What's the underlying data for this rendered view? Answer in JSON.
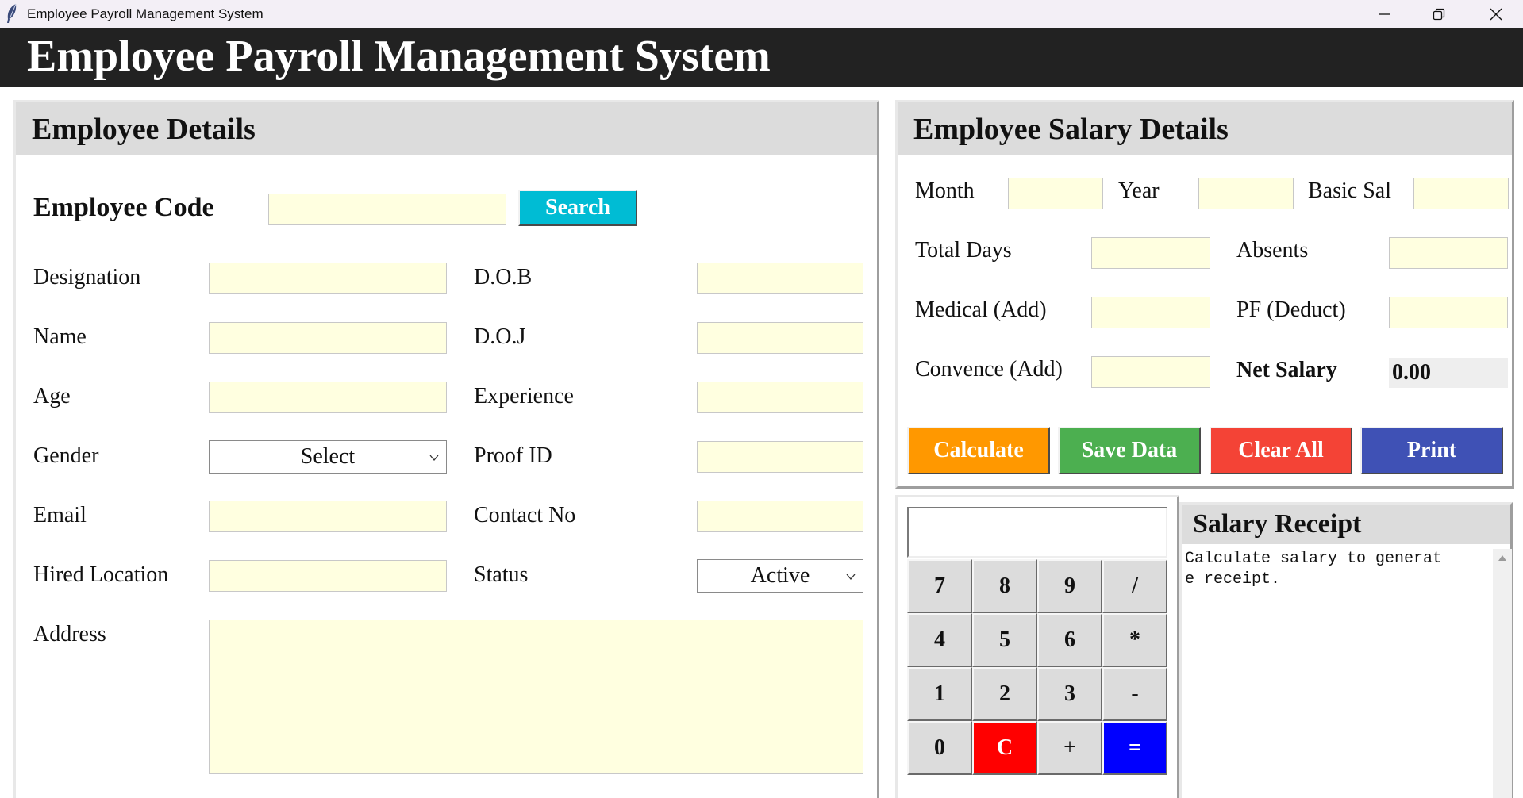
{
  "window": {
    "title": "Employee Payroll Management System",
    "icon": "feather-icon",
    "controls": [
      "minimize-icon",
      "restore-icon",
      "close-icon"
    ]
  },
  "header": {
    "title": "Employee Payroll Management System"
  },
  "employee_details": {
    "heading": "Employee Details",
    "code_label": "Employee Code",
    "code_value": "",
    "search_label": "Search",
    "fields_left": [
      {
        "label": "Designation",
        "value": ""
      },
      {
        "label": "Name",
        "value": ""
      },
      {
        "label": "Age",
        "value": ""
      },
      {
        "label": "Gender",
        "value": "Select"
      },
      {
        "label": "Email",
        "value": ""
      },
      {
        "label": "Hired Location",
        "value": ""
      }
    ],
    "fields_right": [
      {
        "label": "D.O.B",
        "value": ""
      },
      {
        "label": "D.O.J",
        "value": ""
      },
      {
        "label": "Experience",
        "value": ""
      },
      {
        "label": "Proof ID",
        "value": ""
      },
      {
        "label": "Contact No",
        "value": ""
      },
      {
        "label": "Status",
        "value": "Active"
      }
    ],
    "address_label": "Address",
    "address_value": ""
  },
  "salary_details": {
    "heading": "Employee Salary Details",
    "month_label": "Month",
    "year_label": "Year",
    "basic_label": "Basic Sal",
    "total_days_label": "Total Days",
    "absents_label": "Absents",
    "medical_label": "Medical (Add)",
    "pf_label": "PF (Deduct)",
    "convence_label": "Convence (Add)",
    "net_label": "Net Salary",
    "net_value": "0.00",
    "buttons": [
      {
        "label": "Calculate",
        "color": "#ff9800"
      },
      {
        "label": "Save Data",
        "color": "#4caf50"
      },
      {
        "label": "Clear All",
        "color": "#f44336"
      },
      {
        "label": "Print",
        "color": "#3f51b5"
      }
    ]
  },
  "calculator": {
    "display": "",
    "keys": [
      [
        "7",
        "8",
        "9",
        "/"
      ],
      [
        "4",
        "5",
        "6",
        "*"
      ],
      [
        "1",
        "2",
        "3",
        "-"
      ],
      [
        "0",
        "C",
        "+",
        "="
      ]
    ],
    "clear_color": "#ff0000",
    "equals_color": "#0000ff"
  },
  "receipt": {
    "heading": "Salary Receipt",
    "text": "Calculate salary to generat\ne receipt."
  },
  "colors": {
    "header_bg": "#222222",
    "input_bg": "#ffffe0",
    "search_bg": "#00bcd4",
    "panel_head_bg": "#dcdcdc"
  }
}
